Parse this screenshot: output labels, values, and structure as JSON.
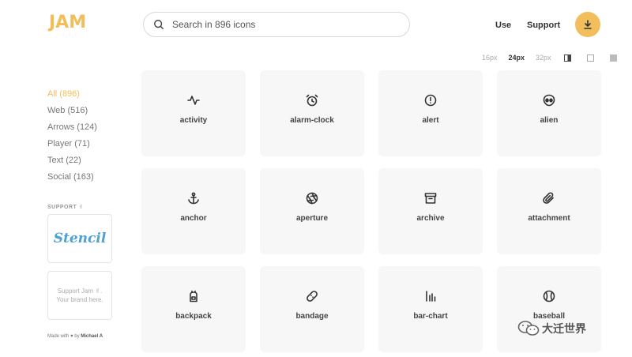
{
  "header": {
    "logo": "JAM",
    "search_placeholder": "Search in 896 icons",
    "nav": [
      {
        "label": "Use"
      },
      {
        "label": "Support"
      }
    ],
    "download_icon": "download-icon",
    "accent": "#f2be5c"
  },
  "toolbar": {
    "sizes": [
      "16px",
      "24px",
      "32px"
    ],
    "selected_size": "24px"
  },
  "sidebar": {
    "categories": [
      {
        "label": "All (896)",
        "active": true
      },
      {
        "label": "Web (516)"
      },
      {
        "label": "Arrows (124)"
      },
      {
        "label": "Player (71)"
      },
      {
        "label": "Text (22)"
      },
      {
        "label": "Social (163)"
      }
    ],
    "support_label": "SUPPORT ✌",
    "ads": {
      "stencil": "Stencil",
      "line1": "Support Jam ✌.",
      "line2": "Your brand here."
    },
    "made_with_prefix": "Made with ♥ by",
    "author": "Michael A"
  },
  "icons": [
    {
      "name": "activity",
      "icon": "activity-icon"
    },
    {
      "name": "alarm-clock",
      "icon": "alarm-clock-icon"
    },
    {
      "name": "alert",
      "icon": "alert-icon"
    },
    {
      "name": "alien",
      "icon": "alien-icon"
    },
    {
      "name": "anchor",
      "icon": "anchor-icon"
    },
    {
      "name": "aperture",
      "icon": "aperture-icon"
    },
    {
      "name": "archive",
      "icon": "archive-icon"
    },
    {
      "name": "attachment",
      "icon": "attachment-icon"
    },
    {
      "name": "backpack",
      "icon": "backpack-icon"
    },
    {
      "name": "bandage",
      "icon": "bandage-icon"
    },
    {
      "name": "bar-chart",
      "icon": "bar-chart-icon"
    },
    {
      "name": "baseball",
      "icon": "baseball-icon"
    }
  ],
  "watermark": "大迁世界"
}
